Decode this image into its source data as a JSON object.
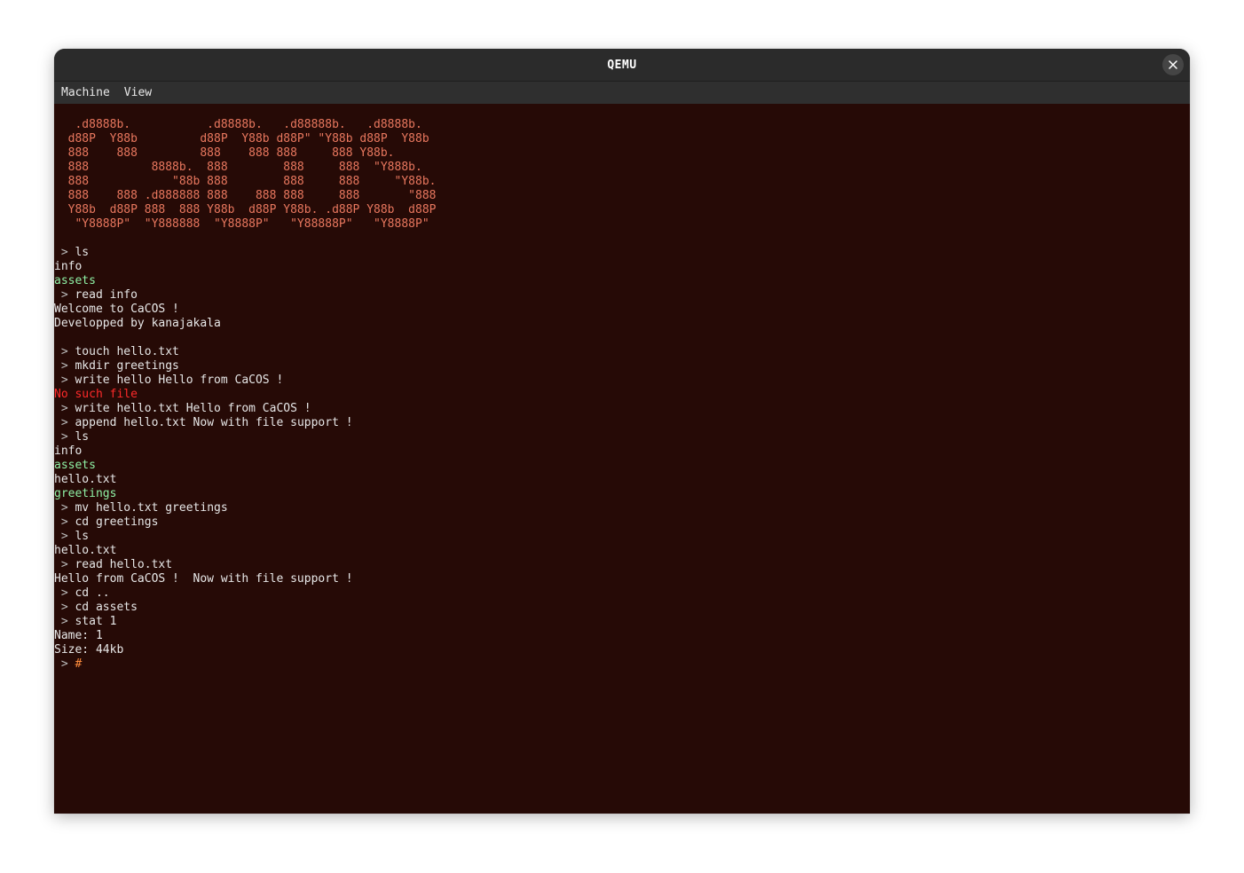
{
  "window": {
    "title": "QEMU",
    "close_icon": "close-icon"
  },
  "menu": [
    "Machine",
    "View"
  ],
  "colors": {
    "screen_bg": "#260a06",
    "banner": "#e8775e",
    "directory": "#8ef0a4",
    "error": "#ff2a2a",
    "cursor": "#ff8c3c"
  },
  "terminal": {
    "banner": [
      "   .d8888b.           .d8888b.   .d88888b.   .d8888b.",
      "  d88P  Y88b         d88P  Y88b d88P\" \"Y88b d88P  Y88b",
      "  888    888         888    888 888     888 Y88b.",
      "  888         8888b.  888        888     888  \"Y888b.",
      "  888            \"88b 888        888     888     \"Y88b.",
      "  888    888 .d888888 888    888 888     888       \"888",
      "  Y88b  d88P 888  888 Y88b  d88P Y88b. .d88P Y88b  d88P",
      "   \"Y8888P\"  \"Y888888  \"Y8888P\"   \"Y88888P\"   \"Y8888P\""
    ],
    "prompt": " > ",
    "lines": [
      {
        "type": "blank",
        "text": ""
      },
      {
        "type": "cmd",
        "text": "ls"
      },
      {
        "type": "out",
        "text": "info"
      },
      {
        "type": "dir",
        "text": "assets"
      },
      {
        "type": "cmd",
        "text": "read info"
      },
      {
        "type": "out",
        "text": "Welcome to CaCOS !"
      },
      {
        "type": "out",
        "text": "Developped by kanajakala"
      },
      {
        "type": "blank",
        "text": ""
      },
      {
        "type": "cmd",
        "text": "touch hello.txt"
      },
      {
        "type": "cmd",
        "text": "mkdir greetings"
      },
      {
        "type": "cmd",
        "text": "write hello Hello from CaCOS !"
      },
      {
        "type": "err",
        "text": "No such file"
      },
      {
        "type": "cmd",
        "text": "write hello.txt Hello from CaCOS !"
      },
      {
        "type": "cmd",
        "text": "append hello.txt Now with file support !"
      },
      {
        "type": "cmd",
        "text": "ls"
      },
      {
        "type": "out",
        "text": "info"
      },
      {
        "type": "dir",
        "text": "assets"
      },
      {
        "type": "out",
        "text": "hello.txt"
      },
      {
        "type": "dir",
        "text": "greetings"
      },
      {
        "type": "cmd",
        "text": "mv hello.txt greetings"
      },
      {
        "type": "cmd",
        "text": "cd greetings"
      },
      {
        "type": "cmd",
        "text": "ls"
      },
      {
        "type": "out",
        "text": "hello.txt"
      },
      {
        "type": "cmd",
        "text": "read hello.txt"
      },
      {
        "type": "out",
        "text": "Hello from CaCOS !  Now with file support !"
      },
      {
        "type": "cmd",
        "text": "cd .."
      },
      {
        "type": "cmd",
        "text": "cd assets"
      },
      {
        "type": "cmd",
        "text": "stat 1"
      },
      {
        "type": "out",
        "text": "Name: 1"
      },
      {
        "type": "out",
        "text": "Size: 44kb"
      }
    ],
    "cursor": "#"
  }
}
